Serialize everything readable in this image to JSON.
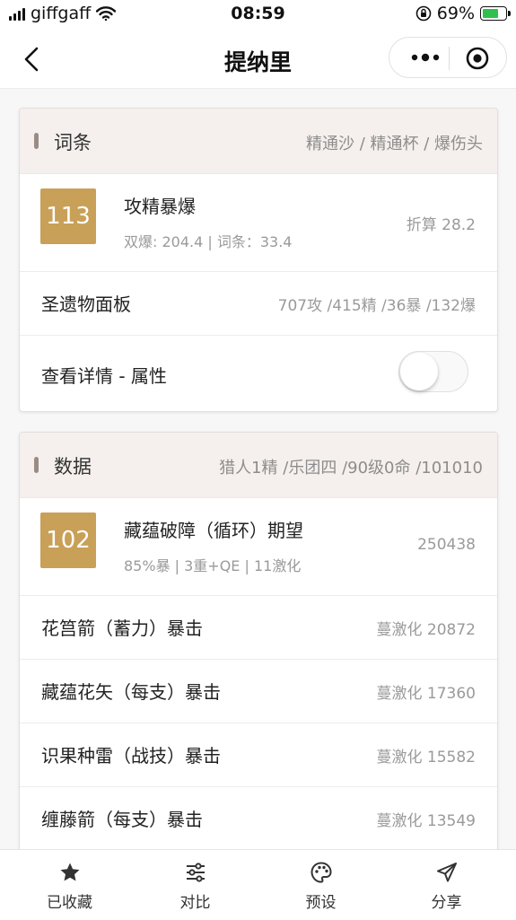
{
  "status_bar": {
    "carrier": "giffgaff",
    "time": "08:59",
    "battery": "69%"
  },
  "nav": {
    "title": "提纳里"
  },
  "card_affix": {
    "header_title": "词条",
    "header_right": "精通沙 / 精通杯 / 爆伤头",
    "summary": {
      "badge": "113",
      "title": "攻精暴爆",
      "subtitle": "双爆: 204.4 | 词条：33.4",
      "right": "折算 28.2"
    },
    "rows": [
      {
        "label": "圣遗物面板",
        "value": "707攻 /415精 /36暴 /132爆"
      }
    ],
    "details_toggle": {
      "label": "查看详情 - 属性",
      "on": false
    }
  },
  "card_data": {
    "header_title": "数据",
    "header_right": "猎人1精 /乐团四 /90级0命 /101010",
    "summary": {
      "badge": "102",
      "title": "藏蕴破障（循环）期望",
      "subtitle": "85%暴 | 3重+QE | 11激化",
      "right": "250438"
    },
    "rows": [
      {
        "label": "花筥箭（蓄力）暴击",
        "value": "蔓激化 20872"
      },
      {
        "label": "藏蕴花矢（每支）暴击",
        "value": "蔓激化 17360"
      },
      {
        "label": "识果种雷（战技）暴击",
        "value": "蔓激化 15582"
      },
      {
        "label": "缠藤箭（每支）暴击",
        "value": "蔓激化 13549"
      }
    ]
  },
  "tabbar": {
    "items": [
      {
        "label": "已收藏",
        "icon": "star-icon"
      },
      {
        "label": "对比",
        "icon": "sliders-icon"
      },
      {
        "label": "预设",
        "icon": "palette-icon"
      },
      {
        "label": "分享",
        "icon": "send-icon"
      }
    ]
  }
}
